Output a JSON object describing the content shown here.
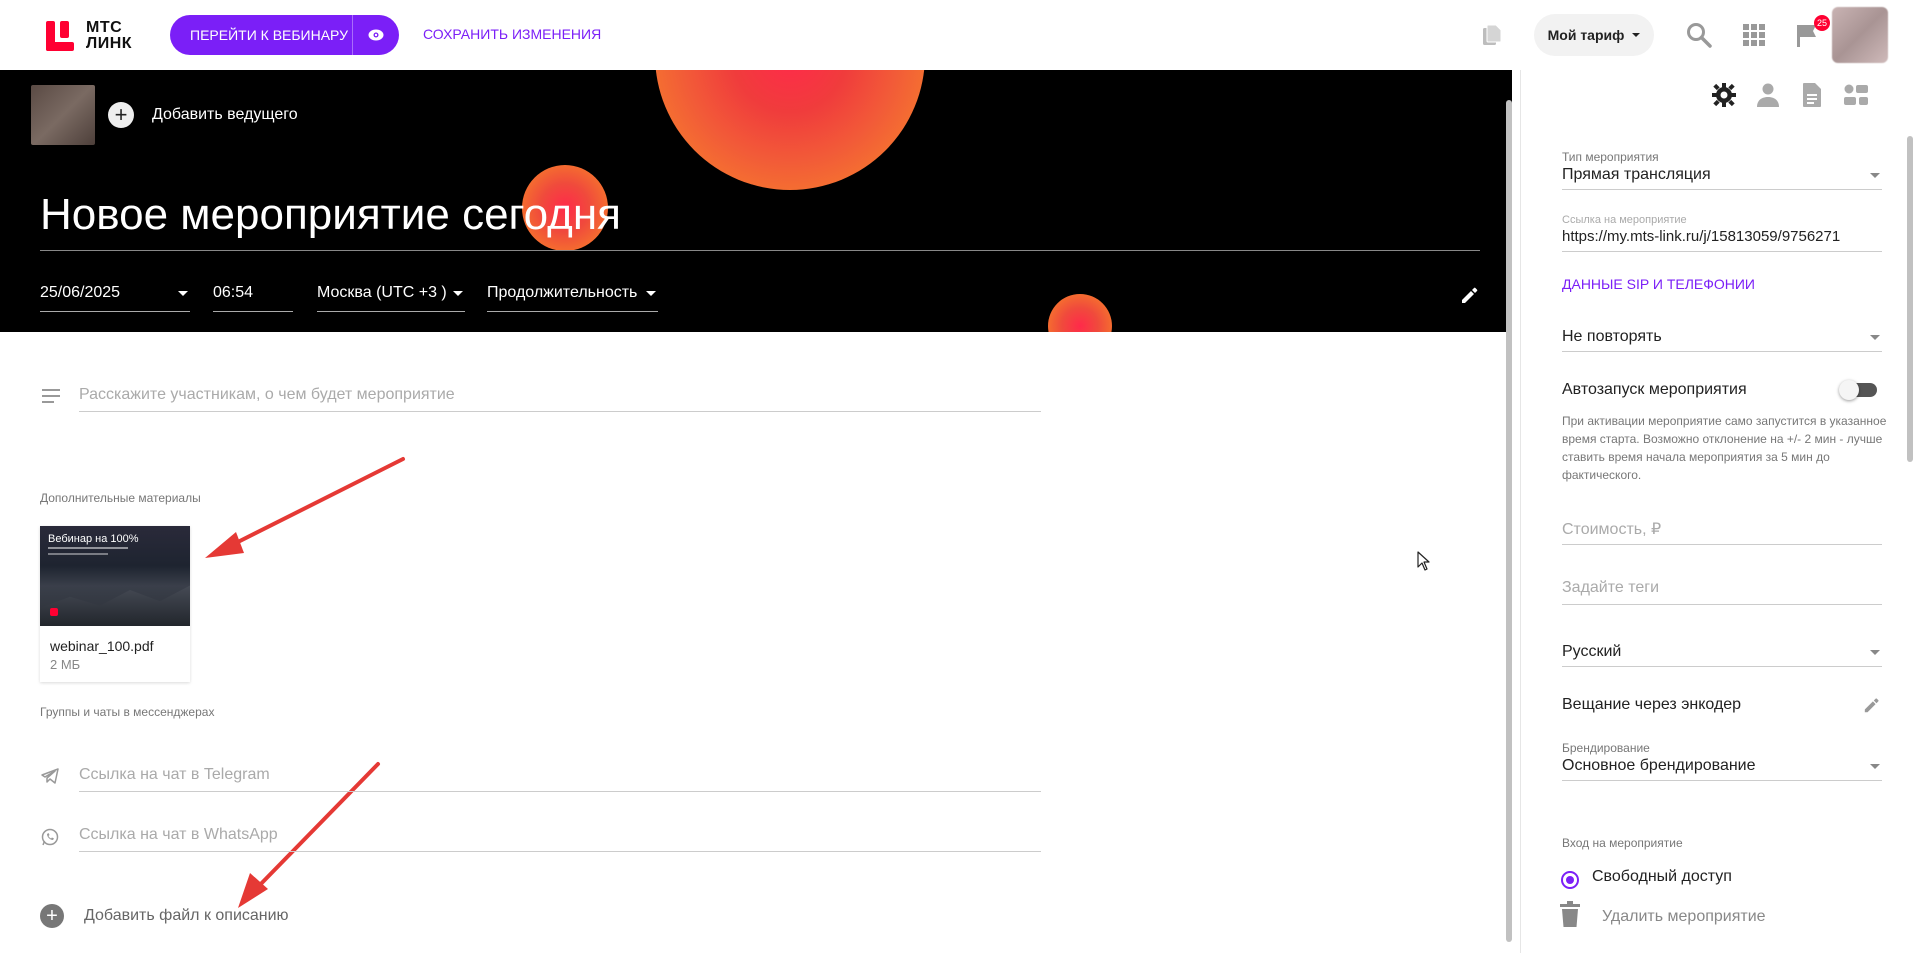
{
  "topbar": {
    "logo_line1": "МТС",
    "logo_line2": "ЛИНК",
    "webinar_button": "ПЕРЕЙТИ К ВЕБИНАРУ",
    "save_button": "СОХРАНИТЬ ИЗМЕНЕНИЯ",
    "tariff": "Мой тариф",
    "notifications_count": "25",
    "brand_color": "#7b1ff7",
    "logo_color": "#ff0032"
  },
  "hero": {
    "add_host": "Добавить ведущего",
    "title": "Новое мероприятие сегодня",
    "date": "25/06/2025",
    "time": "06:54",
    "timezone": "Москва (UTC +3 )",
    "duration": "Продолжительность"
  },
  "main": {
    "description_placeholder": "Расскажите участникам, о чем будет мероприятие",
    "materials_label": "Дополнительные материалы",
    "file": {
      "thumb_title": "Вебинар на 100%",
      "name": "webinar_100.pdf",
      "size": "2 МБ"
    },
    "groups_label": "Группы и чаты в мессенджерах",
    "telegram_placeholder": "Ссылка на чат в Telegram",
    "whatsapp_placeholder": "Ссылка на чат в WhatsApp",
    "add_file": "Добавить файл к описанию"
  },
  "panel": {
    "event_type_label": "Тип мероприятия",
    "event_type": "Прямая трансляция",
    "event_link_label": "Ссылка на мероприятие",
    "event_link": "https://my.mts-link.ru/j/15813059/9756271",
    "sip_link": "ДАННЫЕ SIP И ТЕЛЕФОНИИ",
    "repeat": "Не повторять",
    "autostart_label": "Автозапуск мероприятия",
    "autostart_enabled": false,
    "autostart_help": "При активации мероприятие само запустится в указанное время старта. Возможно отклонение на +/- 2 мин - лучше ставить время начала мероприятия за 5 мин до фактического.",
    "price_placeholder": "Стоимость, ₽",
    "tags_placeholder": "Задайте теги",
    "language": "Русский",
    "encoder_label": "Вещание через энкодер",
    "branding_label": "Брендирование",
    "branding": "Основное брендирование",
    "access_label": "Вход на мероприятие",
    "access_option": "Свободный доступ",
    "delete": "Удалить мероприятие"
  }
}
